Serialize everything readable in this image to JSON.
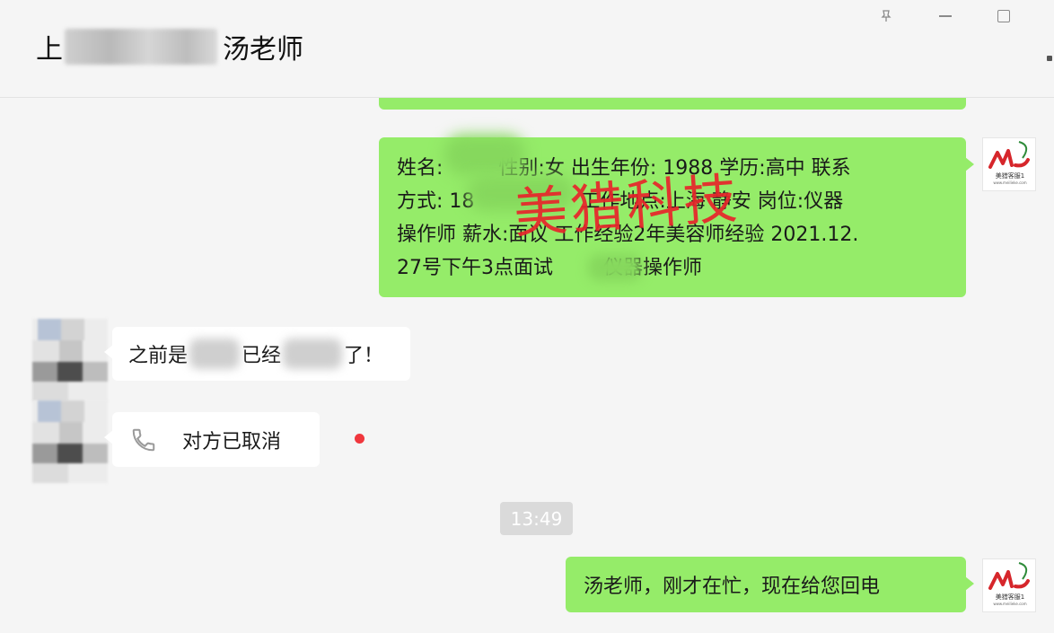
{
  "window": {
    "title_prefix": "上",
    "title_suffix": "汤老师",
    "pin_icon": "📌"
  },
  "watermark": "美猎科技",
  "messages": {
    "info_bubble": {
      "line1_a": "姓名:",
      "line1_b": "性别:女 出生年份: 1988 学历:高中 联系",
      "line2_a": "方式: 18",
      "line2_b": "工作地点:上海 静安 岗位:仪器",
      "line3": "操作师 薪水:面议 工作经验2年美容师经验 2021.12.",
      "line4_a": "27号下午3点面试",
      "line4_b": "仪器操作师"
    },
    "contact_msg": {
      "part1": "之前是",
      "part2": "已经",
      "part3": "了！"
    },
    "call": {
      "text": "对方已取消",
      "icon": "phone-icon"
    },
    "timestamp": "13:49",
    "reply": "汤老师，刚才在忙，现在给您回电"
  },
  "avatar_logo": {
    "text": "美猎客服1",
    "sub": "www.meilieke.com",
    "accent": "#d6262b",
    "leaf": "#2e8b3a"
  },
  "colors": {
    "bubble_green": "#95ec69",
    "bubble_white": "#ffffff",
    "background": "#f5f5f5",
    "unread_dot": "#f0373d",
    "watermark": "#e8252b"
  }
}
